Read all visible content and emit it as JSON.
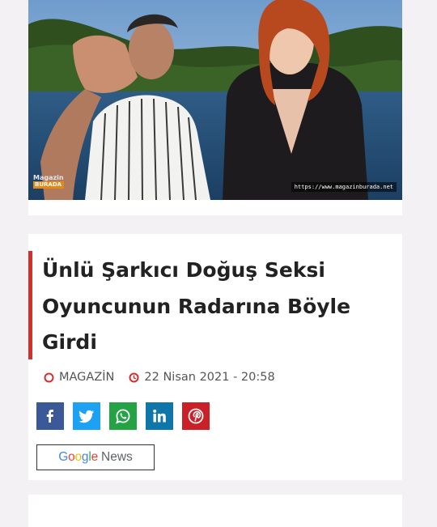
{
  "hero": {
    "watermark_url": "https://www.magazinburada.net",
    "logo_line1": "Magazin",
    "logo_line2": "BURADA"
  },
  "article": {
    "title": "Ünlü Şarkıcı Doğuş Seksi Oyuncunun Radarına Böyle Girdi",
    "category": "MAGAZİN",
    "date": "22 Nisan 2021 - 20:58"
  },
  "share": [
    {
      "network": "facebook",
      "color": "#3b5998",
      "icon": "facebook-icon"
    },
    {
      "network": "twitter",
      "color": "#1da1f2",
      "icon": "twitter-icon"
    },
    {
      "network": "whatsapp",
      "color": "#25a244",
      "icon": "whatsapp-icon"
    },
    {
      "network": "linkedin",
      "color": "#0e76a8",
      "icon": "linkedin-icon"
    },
    {
      "network": "pinterest",
      "color": "#cb2027",
      "icon": "pinterest-icon"
    }
  ],
  "google_news": {
    "brand": "Google",
    "label": "News"
  },
  "colors": {
    "accent": "#d0312d",
    "background": "#f3f1f3"
  }
}
